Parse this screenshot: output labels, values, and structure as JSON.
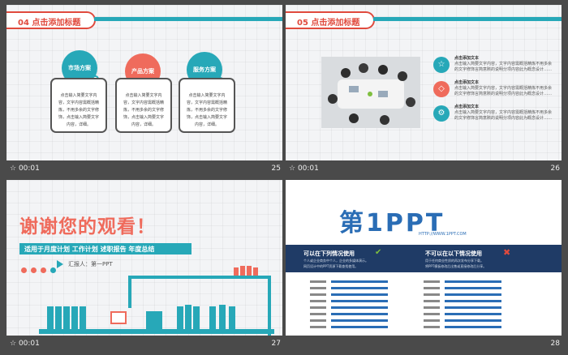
{
  "slides": [
    {
      "number": "25",
      "time": "00:01",
      "title": "04 点击添加标题",
      "items": [
        {
          "label": "市场方案",
          "text": "点击输入简要文字内容，文字内容需概括精炼，不用多余的文字修饰，点击输入简要文字内容，详细。"
        },
        {
          "label": "产品方案",
          "text": "点击输入简要文字内容，文字内容需概括精炼，不用多余的文字修饰，点击输入简要文字内容，详细。"
        },
        {
          "label": "服务方案",
          "text": "点击输入简要文字内容，文字内容需概括精炼，不用多余的文字修饰，点击输入简要文字内容，详细。"
        }
      ]
    },
    {
      "number": "26",
      "time": "00:01",
      "title": "05 点击添加标题",
      "features": [
        {
          "title": "点击添加文本",
          "text": "点击输入简要文字内容，文字内容需概括精炼不用多余的文字修饰言简意赅的说明分项内容此为概念设计……",
          "icon": "☆"
        },
        {
          "title": "点击添加文本",
          "text": "点击输入简要文字内容，文字内容需概括精炼不用多余的文字修饰言简意赅的说明分项内容此为概念设计……",
          "icon": "◇"
        },
        {
          "title": "点击添加文本",
          "text": "点击输入简要文字内容，文字内容需概括精炼不用多余的文字修饰言简意赅的说明分项内容此为概念设计……",
          "icon": "⚙"
        }
      ]
    },
    {
      "number": "27",
      "time": "00:01",
      "headline": "谢谢您的观看！",
      "subtitle": "适用于月度计划 工作计划 述职报告 年度总结",
      "reporter": "汇报人：第一PPT"
    },
    {
      "number": "28",
      "time": "",
      "logo_text": "第1PPT",
      "logo_url": "HTTP://WWW.1PPT.COM",
      "can_use_title": "可以在下列情况使用",
      "cannot_use_title": "不可以在以下情况使用",
      "can_use_items": [
        "个人或企业商务中个人，企业的多媒体演示。",
        "网页设计中的PPT资源下载查找使用。"
      ],
      "cannot_use_items": [
        "用于任何商业性质的再次发布分享下载。",
        "将PPT模板修改后出售或直接修改后分享。"
      ]
    }
  ]
}
